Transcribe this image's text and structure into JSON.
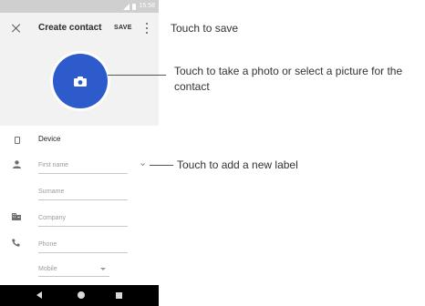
{
  "status_bar": {
    "time": "15:58"
  },
  "header": {
    "title": "Create contact",
    "save_label": "SAVE"
  },
  "account": {
    "label": "Device"
  },
  "fields": {
    "first_name": "First name",
    "surname": "Surname",
    "company": "Company",
    "phone": "Phone",
    "phone_type": "Mobile"
  },
  "callouts": {
    "save": "Touch to save",
    "photo": "Touch to take a photo or select a picture for the contact",
    "label": "Touch to add a new label"
  },
  "colors": {
    "accent": "#2e5bcc",
    "header_bg": "#f2f2f2",
    "status_bar": "#cfcfcf",
    "nav_bar": "#000000"
  },
  "icons": [
    "close-icon",
    "more-icon",
    "camera-icon",
    "device-icon",
    "person-icon",
    "chevron-down-icon",
    "company-icon",
    "phone-icon",
    "back-icon",
    "home-icon",
    "recents-icon"
  ]
}
